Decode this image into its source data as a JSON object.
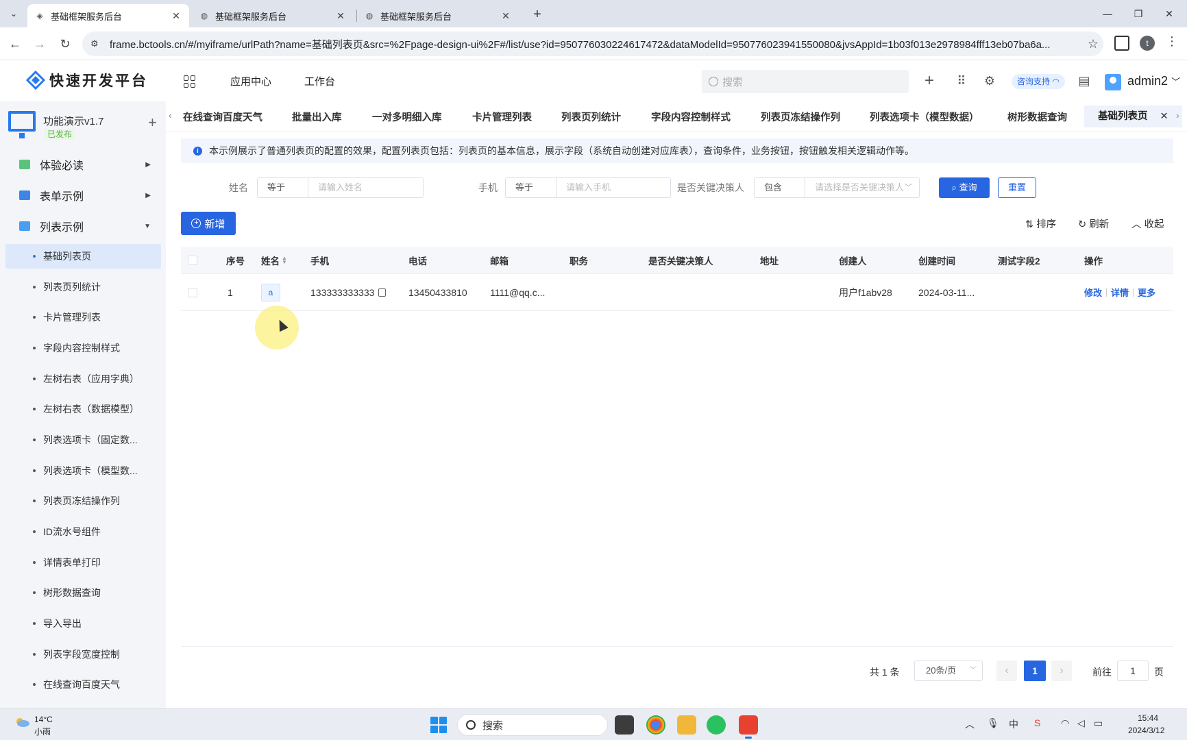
{
  "browser": {
    "tabs": [
      {
        "title": "基础框架服务后台",
        "active": true
      },
      {
        "title": "基础框架服务后台",
        "active": false
      },
      {
        "title": "基础框架服务后台",
        "active": false
      }
    ],
    "new_tab": "+",
    "url": "frame.bctools.cn/#/myiframe/urlPath?name=基础列表页&src=%2Fpage-design-ui%2F#/list/use?id=950776030224617472&dataModelId=950776023941550080&jvsAppId=1b03f013e2978984fff13eb07ba6a...",
    "profile_initial": "t"
  },
  "header": {
    "logo_text": "快速开发平台",
    "nav": [
      "应用中心",
      "工作台"
    ],
    "search_placeholder": "搜索",
    "consult_label": "咨询支持",
    "user_name": "admin2"
  },
  "sidebar": {
    "app_name": "功能演示v1.7",
    "app_status": "已发布",
    "groups": [
      {
        "label": "体验必读",
        "color": "#5ac27a"
      },
      {
        "label": "表单示例",
        "color": "#3b86e6"
      },
      {
        "label": "列表示例",
        "color": "#4a9ef0"
      }
    ],
    "items": [
      "基础列表页",
      "列表页列统计",
      "卡片管理列表",
      "字段内容控制样式",
      "左树右表（应用字典）",
      "左树右表（数据模型）",
      "列表选项卡（固定数...",
      "列表选项卡（模型数...",
      "列表页冻结操作列",
      "ID流水号组件",
      "详情表单打印",
      "树形数据查询",
      "导入导出",
      "列表字段宽度控制",
      "在线查询百度天气"
    ],
    "active_item": "基础列表页"
  },
  "page_tabs": [
    "在线查询百度天气",
    "批量出入库",
    "一对多明细入库",
    "卡片管理列表",
    "列表页列统计",
    "字段内容控制样式",
    "列表页冻结操作列",
    "列表选项卡（模型数据）",
    "树形数据查询",
    "基础列表页"
  ],
  "notice": "本示例展示了普通列表页的配置的效果，配置列表页包括：列表页的基本信息，展示字段（系统自动创建对应库表），查询条件，业务按钮，按钮触发相关逻辑动作等。",
  "query": {
    "fields": [
      {
        "label": "姓名",
        "op": "等于",
        "placeholder": "请输入姓名"
      },
      {
        "label": "手机",
        "op": "等于",
        "placeholder": "请输入手机"
      },
      {
        "label": "是否关键决策人",
        "op": "包含",
        "placeholder": "请选择是否关键决策人"
      }
    ],
    "query_btn": "查询",
    "reset_btn": "重置"
  },
  "toolbar": {
    "add_btn": "新增",
    "sort": "排序",
    "refresh": "刷新",
    "collapse": "收起"
  },
  "table": {
    "headers": [
      "序号",
      "姓名",
      "手机",
      "电话",
      "邮箱",
      "职务",
      "是否关键决策人",
      "地址",
      "创建人",
      "创建时间",
      "测试字段2",
      "操作"
    ],
    "rows": [
      {
        "index": "1",
        "name": "a",
        "mobile": "133333333333",
        "phone": "13450433810",
        "email": "1111@qq.c...",
        "position": "",
        "decision_maker": "",
        "address": "",
        "creator": "用户f1abv28",
        "created_at": "2024-03-11...",
        "test_field2": "",
        "actions": [
          "修改",
          "详情",
          "更多"
        ]
      }
    ]
  },
  "pager": {
    "total": "共 1 条",
    "page_size": "20条/页",
    "current_page": "1",
    "goto_prefix": "前往",
    "goto_value": "1",
    "goto_suffix": "页"
  },
  "taskbar": {
    "temperature": "14°C",
    "weather": "小雨",
    "search": "搜索",
    "time": "15:44",
    "date": "2024/3/12",
    "ime": "中"
  },
  "colors": {
    "primary": "#2766e0",
    "sidebar_bg": "#f3f5f8",
    "active_menu_bg": "#dde9fb"
  }
}
